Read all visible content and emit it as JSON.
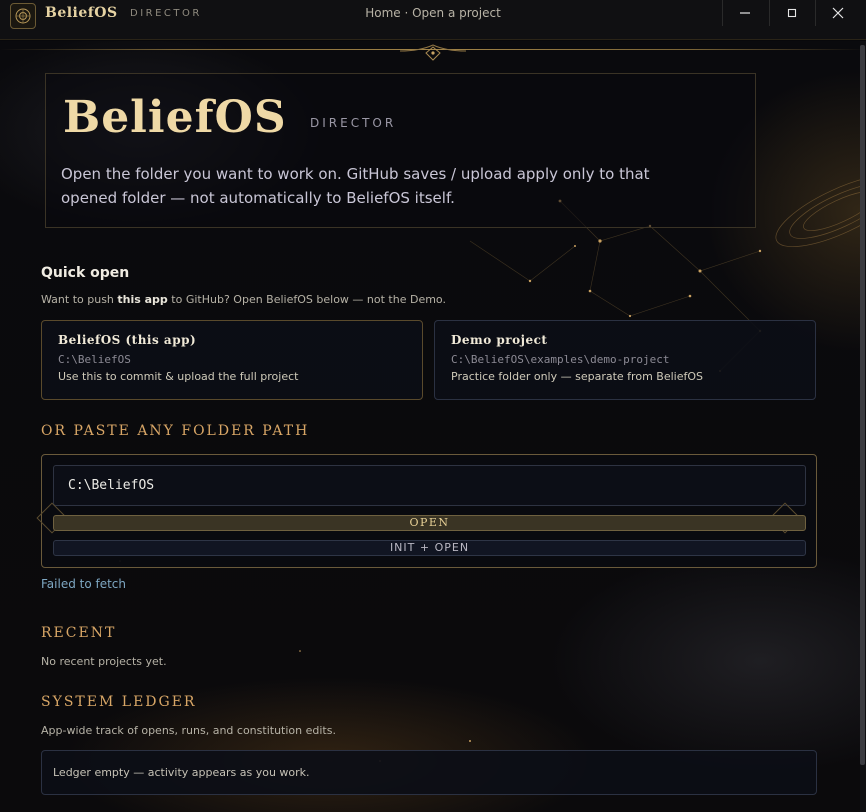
{
  "titlebar": {
    "brand": "BeliefOS",
    "brand_sub": "DIRECTOR",
    "breadcrumb": "Home · Open a project",
    "minimize_icon": "minimize-icon",
    "maximize_icon": "maximize-icon",
    "close_icon": "close-icon"
  },
  "hero": {
    "title": "BeliefOS",
    "subtitle": "DIRECTOR",
    "description": "Open the folder you want to work on. GitHub saves / upload apply only to that opened folder — not automatically to BeliefOS itself."
  },
  "quick_open": {
    "heading": "Quick open",
    "hint_before": "Want to push ",
    "hint_bold": "this app",
    "hint_after": " to GitHub? Open BeliefOS below — not the Demo.",
    "cards": [
      {
        "title": "BeliefOS (this app)",
        "path": "C:\\BeliefOS",
        "note": "Use this to commit & upload the full project"
      },
      {
        "title": "Demo project",
        "path": "C:\\BeliefOS\\examples\\demo-project",
        "note": "Practice folder only — separate from BeliefOS"
      }
    ]
  },
  "paste_path": {
    "heading": "OR PASTE ANY FOLDER PATH",
    "value": "C:\\BeliefOS",
    "open_label": "OPEN",
    "init_open_label": "INIT + OPEN"
  },
  "status": {
    "error": "Failed to fetch"
  },
  "recent": {
    "heading": "RECENT",
    "empty": "No recent projects yet."
  },
  "ledger": {
    "heading": "SYSTEM LEDGER",
    "description": "App-wide track of opens, runs, and constitution edits.",
    "empty": "Ledger empty — activity appears as you work."
  },
  "colors": {
    "accent_gold": "#d8a666",
    "title_gold": "#efd9a6",
    "error_blue": "#7ea7c2"
  }
}
